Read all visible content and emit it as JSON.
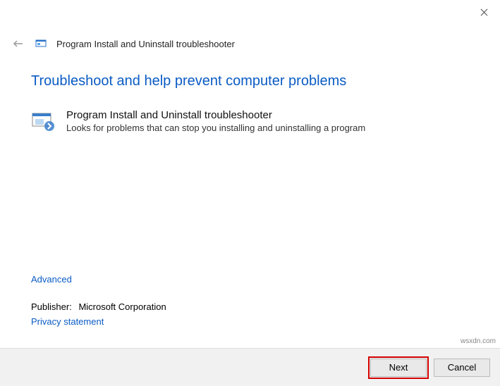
{
  "window": {
    "title": "Program Install and Uninstall troubleshooter"
  },
  "heading": "Troubleshoot and help prevent computer problems",
  "troubleshooter": {
    "title": "Program Install and Uninstall troubleshooter",
    "description": "Looks for problems that can stop you installing and uninstalling a program"
  },
  "links": {
    "advanced": "Advanced",
    "privacy": "Privacy statement"
  },
  "publisher": {
    "label": "Publisher:",
    "name": "Microsoft Corporation"
  },
  "buttons": {
    "next": "Next",
    "cancel": "Cancel"
  },
  "watermark": "wsxdn.com"
}
